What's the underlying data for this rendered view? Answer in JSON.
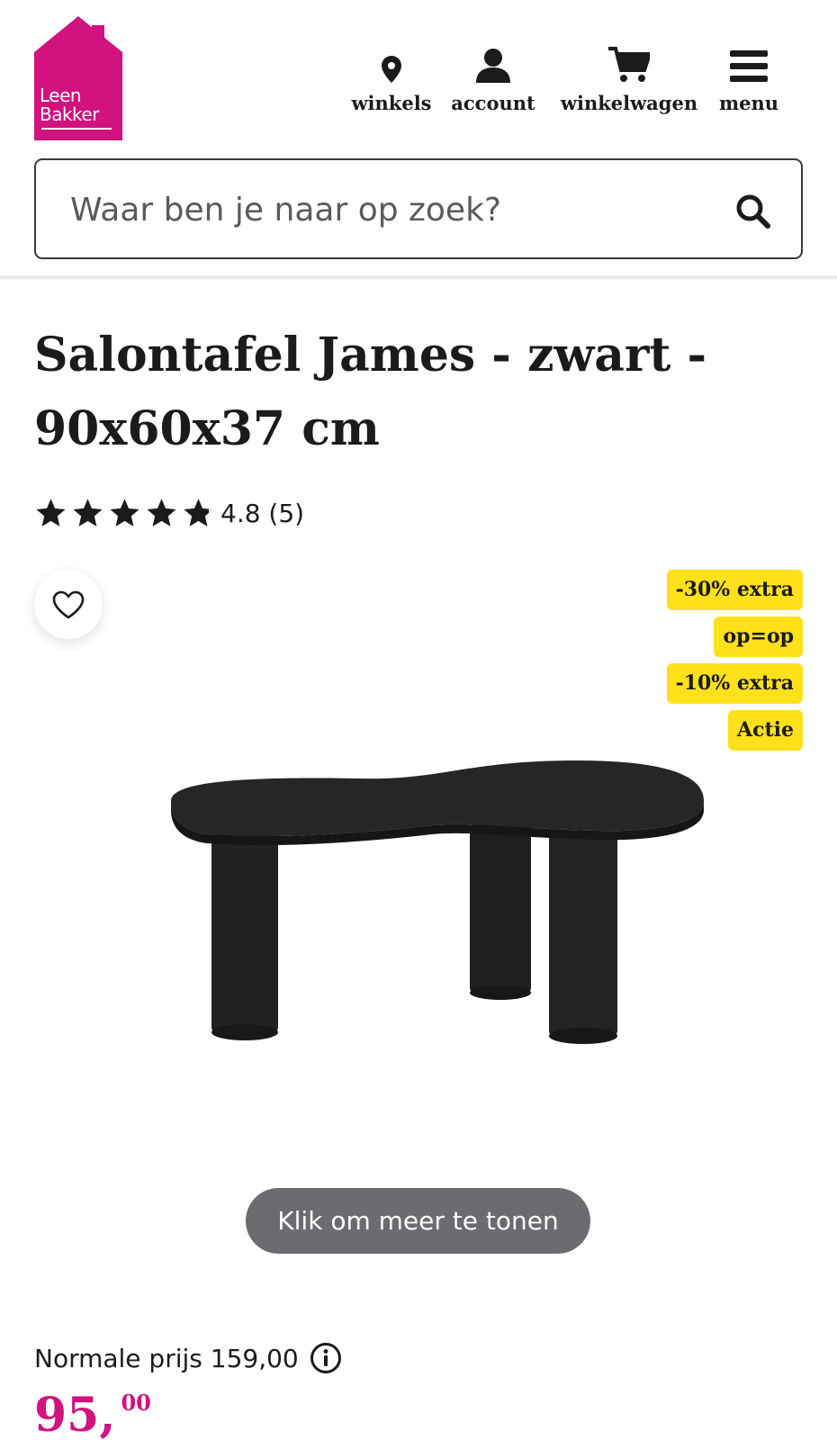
{
  "brand": {
    "logo_line1": "Leen",
    "logo_line2": "Bakker",
    "color": "#d1127f"
  },
  "nav": {
    "items": [
      {
        "label": "winkels",
        "icon": "map-pin-icon"
      },
      {
        "label": "account",
        "icon": "user-icon"
      },
      {
        "label": "winkelwagen",
        "icon": "shopping-cart-icon"
      },
      {
        "label": "menu",
        "icon": "hamburger-icon"
      }
    ]
  },
  "search": {
    "placeholder": "Waar ben je naar op zoek?",
    "icon": "search-icon"
  },
  "product": {
    "title": "Salontafel James - zwart - 90x60x37 cm",
    "rating_text": "4.8 (5)",
    "rating_value": 4.8,
    "rating_max": 5,
    "badges": [
      "-30% extra",
      "op=op",
      "-10% extra",
      "Actie"
    ],
    "badge_color": "#ffe11a",
    "show_more": "Klik om meer te tonen",
    "normal_price": "Normale prijs 159,00",
    "price_main": "95,",
    "price_cents": "00",
    "price_color": "#d1127f"
  }
}
